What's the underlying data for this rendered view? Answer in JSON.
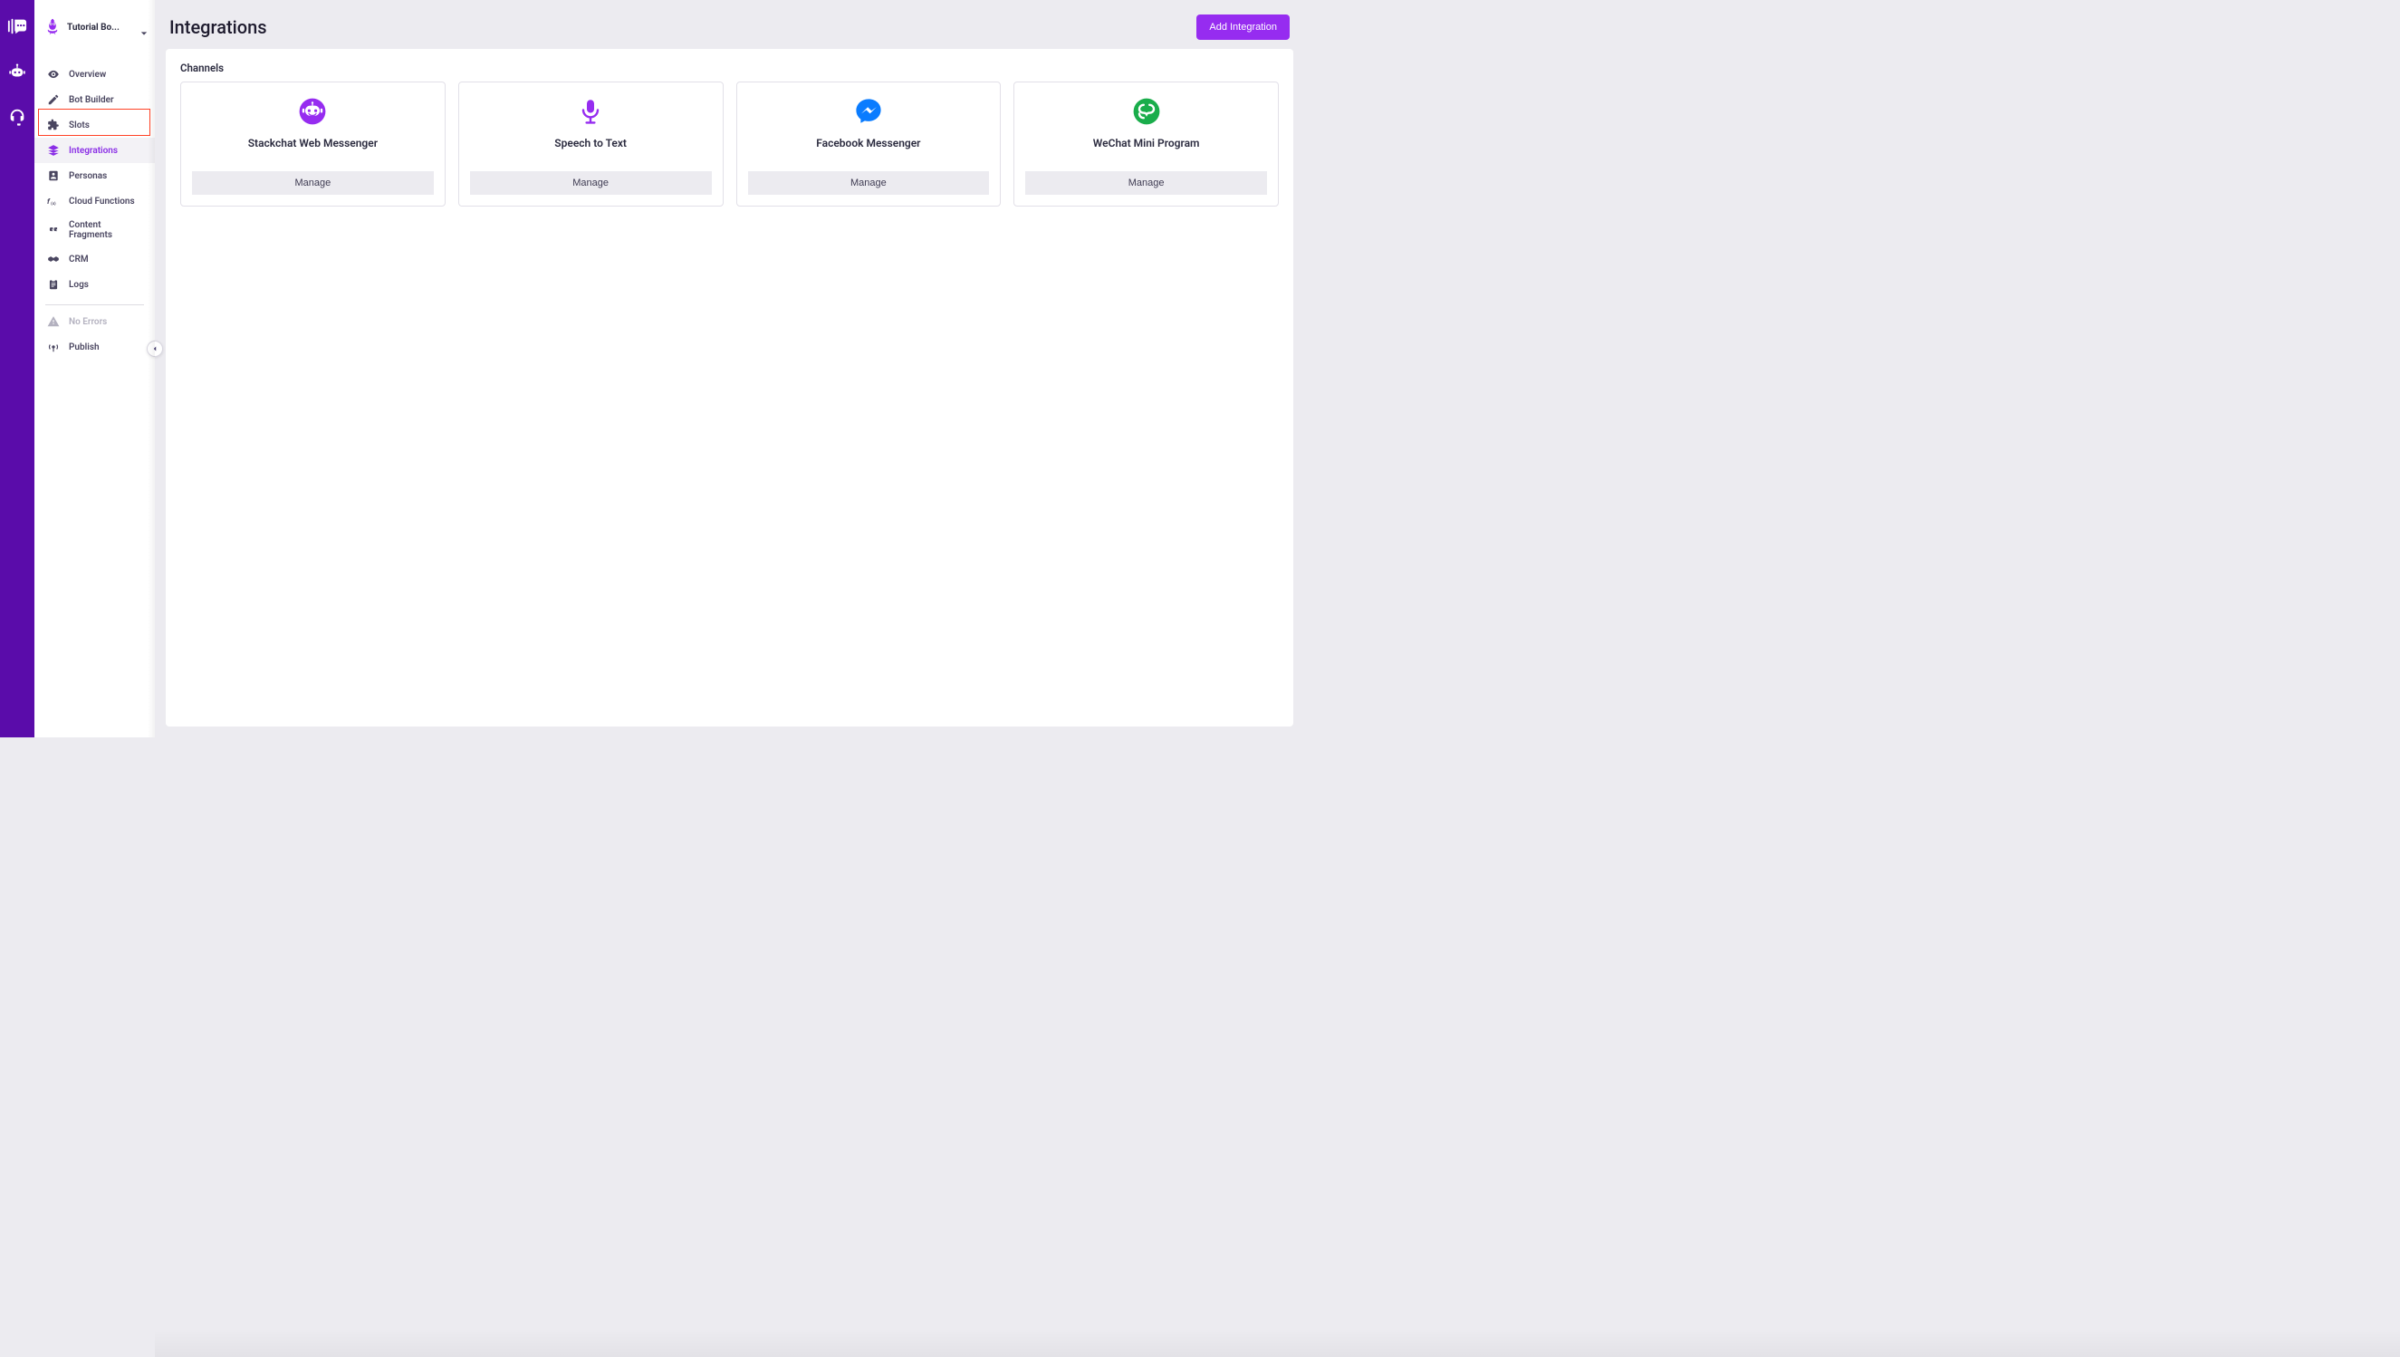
{
  "bot": {
    "name": "Tutorial Bo..."
  },
  "nav": {
    "items": [
      {
        "label": "Overview"
      },
      {
        "label": "Bot Builder"
      },
      {
        "label": "Slots"
      },
      {
        "label": "Integrations"
      },
      {
        "label": "Personas"
      },
      {
        "label": "Cloud Functions"
      },
      {
        "label": "Content Fragments"
      },
      {
        "label": "CRM"
      },
      {
        "label": "Logs"
      }
    ],
    "no_errors": "No Errors",
    "publish": "Publish"
  },
  "page": {
    "title": "Integrations",
    "add_button": "Add Integration"
  },
  "channels": {
    "section_title": "Channels",
    "manage_label": "Manage",
    "cards": [
      {
        "title": "Stackchat Web Messenger"
      },
      {
        "title": "Speech to Text"
      },
      {
        "title": "Facebook Messenger"
      },
      {
        "title": "WeChat Mini Program"
      }
    ]
  }
}
